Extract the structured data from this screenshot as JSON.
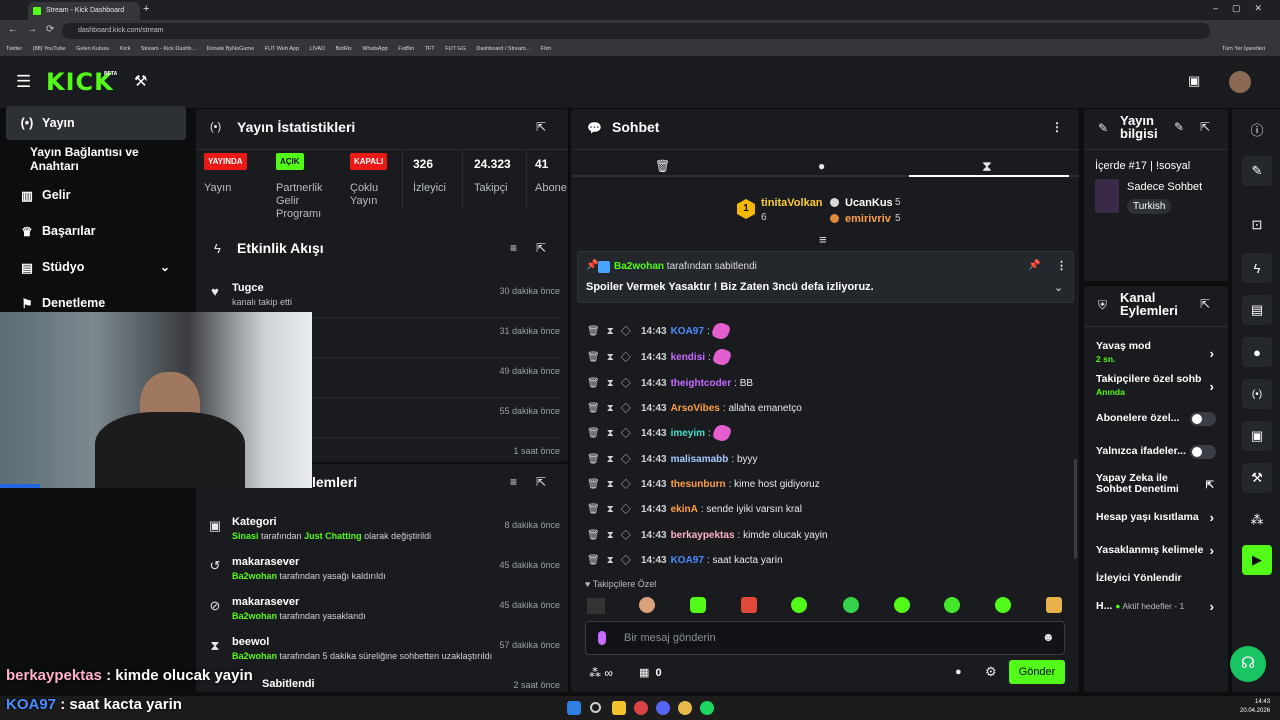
{
  "browser": {
    "tab_title": "Stream - Kick Dashboard",
    "url": "dashboard.kick.com/stream",
    "bookmarks": [
      "Twitter",
      "(88) YouTube",
      "Gelen Kutusu",
      "Kick",
      "Stream - Kick Dashb...",
      "Donate ByNoGame",
      "FUT Web App",
      "LİVAD",
      "BotRix",
      "WhatsApp",
      "FutBin",
      "TFT",
      "FUT GG",
      "Dashboard / Stream...",
      "Film"
    ],
    "all_bookmarks": "Tüm Yer İşaretleri"
  },
  "brand": {
    "logo": "KICK",
    "beta": "BETA"
  },
  "sidebar": {
    "items": [
      {
        "label": "Yayın",
        "icon": "broadcast-icon"
      },
      {
        "label": "Yayın Bağlantısı ve Anahtarı"
      },
      {
        "label": "Gelir",
        "icon": "chart-icon"
      },
      {
        "label": "Başarılar",
        "icon": "trophy-icon"
      },
      {
        "label": "Stüdyo",
        "icon": "studio-icon"
      },
      {
        "label": "Denetleme",
        "icon": "moderation-icon"
      }
    ]
  },
  "stats": {
    "title": "Yayın İstatistikleri",
    "cols": [
      {
        "badge": "YAYINDA",
        "label": "Yayın"
      },
      {
        "badge": "AÇIK",
        "label": "Partnerlik Gelir Programı"
      },
      {
        "badge": "KAPALI",
        "label": "Çoklu Yayın"
      },
      {
        "value": "326",
        "label": "İzleyici"
      },
      {
        "value": "24.323",
        "label": "Takipçi"
      },
      {
        "value": "41",
        "label": "Abone Sayısı"
      }
    ]
  },
  "activity": {
    "title": "Etkinlik Akışı",
    "items": [
      {
        "name": "Tugce",
        "sub": "kanalı takip etti",
        "time": "30 dakika önce"
      },
      {
        "name": "",
        "sub": "",
        "time": "31 dakika önce"
      },
      {
        "name": "",
        "sub": "",
        "time": "49 dakika önce"
      },
      {
        "name": "",
        "sub": "",
        "time": "55 dakika önce"
      },
      {
        "name": "",
        "sub": "",
        "time": "1 saat önce"
      }
    ]
  },
  "modlog": {
    "title_partial": "lemleri",
    "items": [
      {
        "name": "Kategori",
        "actor": "Sinasi",
        "mid": " tarafından ",
        "extra": "Just Chatting",
        "tail": " olarak değiştirildi",
        "time": "8 dakika önce"
      },
      {
        "name": "makarasever",
        "actor": "Ba2wohan",
        "mid": " tarafından yasağı kaldırıldı",
        "time": "45 dakika önce"
      },
      {
        "name": "makarasever",
        "actor": "Ba2wohan",
        "mid": " tarafından yasaklandı",
        "time": "45 dakika önce"
      },
      {
        "name": "beewol",
        "actor": "Ba2wohan",
        "mid": " tarafından 5 dakika süreliğine sohbetten uzaklaştırıldı",
        "time": "57 dakika önce"
      },
      {
        "name": "Sabitlendi",
        "time": "2 saat önce"
      }
    ]
  },
  "chat": {
    "title": "Sohbet",
    "leaders": [
      {
        "rank": "1",
        "name": "tinitaVolkan",
        "count": "6"
      },
      {
        "name": "UcanKus",
        "count": "5"
      },
      {
        "name": "emirivriv",
        "count": "5"
      }
    ],
    "pinned": {
      "by_user": "Ba2wohan",
      "by_text": " tarafından sabitlendi",
      "message": "Spoiler Vermek Yasaktır ! Biz Zaten 3ncü defa izliyoruz."
    },
    "messages": [
      {
        "time": "14:43",
        "user": "KOA97",
        "color": "#4a8cff",
        "text": "",
        "emote": true
      },
      {
        "time": "14:43",
        "user": "kendisi",
        "color": "#c76bff",
        "text": "",
        "emote": true
      },
      {
        "time": "14:43",
        "user": "theightcoder",
        "color": "#c76bff",
        "text": "BB"
      },
      {
        "time": "14:43",
        "user": "ArsoVibes",
        "color": "#ff9f43",
        "text": "allaha emanetço"
      },
      {
        "time": "14:43",
        "user": "imeyim",
        "color": "#3fe0c5",
        "text": "",
        "emote": true
      },
      {
        "time": "14:43",
        "user": "malisamabb",
        "color": "#a6c8ff",
        "text": "byyy"
      },
      {
        "time": "14:43",
        "user": "thesunburn",
        "color": "#ff9f43",
        "text": "kime host gidiyoruz"
      },
      {
        "time": "14:43",
        "user": "ekinA",
        "color": "#ff9f43",
        "text": "sende iyiki varsın kral"
      },
      {
        "time": "14:43",
        "user": "berkaypektas",
        "color": "#ffb3c7",
        "text": "kimde olucak yayin"
      },
      {
        "time": "14:43",
        "user": "KOA97",
        "color": "#4a8cff",
        "text": "saat kacta yarin"
      }
    ],
    "followers_only": "Takipçilere Özel",
    "placeholder": "Bir mesaj gönderin",
    "points": "∞",
    "gift_count": "0",
    "send": "Gönder"
  },
  "stream_info": {
    "title": "Yayın bilgisi",
    "stream_title": "İçerde #17 | !sosyal",
    "category": "Sadece Sohbet",
    "language": "Turkish"
  },
  "channel_actions": {
    "title": "Kanal Eylemleri",
    "items": [
      {
        "label": "Yavaş mod",
        "sub": "2 sn.",
        "kind": "chevron"
      },
      {
        "label": "Takipçilere özel sohb",
        "sub": "Anında",
        "kind": "chevron"
      },
      {
        "label": "Abonelere özel...",
        "kind": "toggle"
      },
      {
        "label": "Yalnızca ifadeler...",
        "kind": "toggle"
      },
      {
        "label": "Yapay Zeka ile Sohbet Denetimi",
        "kind": "external"
      },
      {
        "label": "Hesap yaşı kısıtlama",
        "kind": "chevron"
      },
      {
        "label": "Yasaklanmış kelimele",
        "kind": "chevron"
      },
      {
        "label": "İzleyici Yönlendir",
        "kind": "none"
      },
      {
        "label": "H...",
        "sub_inline": "Aktif hedefler - 1",
        "kind": "chevron"
      }
    ]
  },
  "overlay_chat": [
    {
      "user": "berkaypektas",
      "text": " : kimde olucak yayin",
      "color": "#ffb3c7"
    },
    {
      "user": "KOA97",
      "text": " : saat kacta yarin",
      "color": "#4a8cff"
    }
  ],
  "taskbar": {
    "clock": "14:43",
    "date": "20.04.2026"
  },
  "colors": {
    "accent": "#53fc18",
    "live": "#e91916",
    "panel": "#191b1f",
    "bg": "#0b0d0f"
  }
}
